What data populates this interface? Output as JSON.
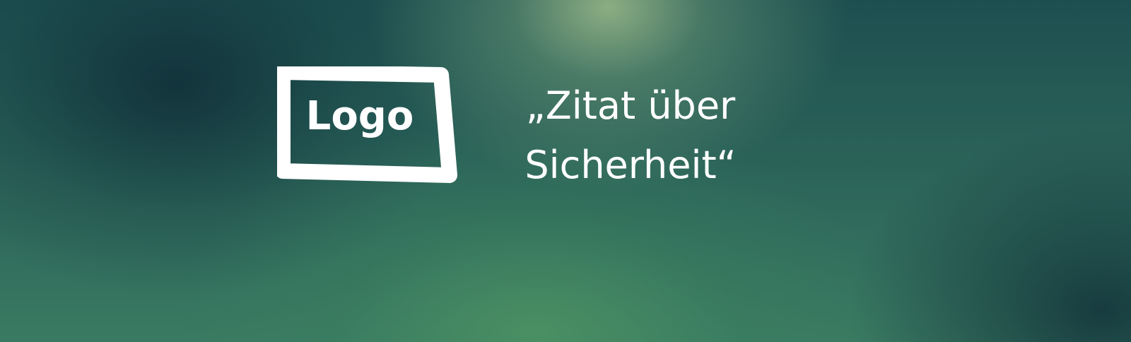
{
  "logo": {
    "label": "Logo"
  },
  "quote": {
    "text": "„Zitat über Sicherheit“"
  },
  "colors": {
    "text": "#ffffff",
    "background_dark": "#1d4f50",
    "background_light": "#8fae84"
  }
}
